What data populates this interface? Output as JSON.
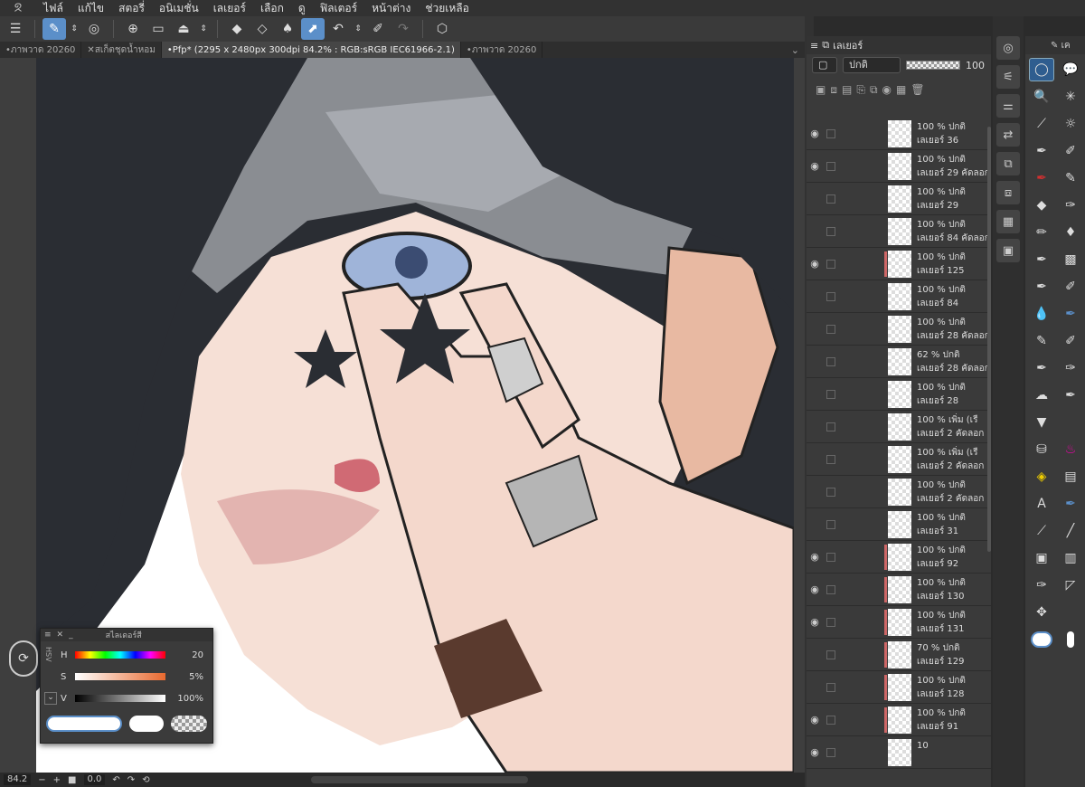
{
  "menubar": {
    "items": [
      "ไฟล์",
      "แก้ไข",
      "สตอรี่",
      "อนิเมชั่น",
      "เลเยอร์",
      "เลือก",
      "ดู",
      "ฟิลเตอร์",
      "หน้าต่าง",
      "ช่วยเหลือ"
    ]
  },
  "toolbar": {
    "icons": [
      "menu-icon",
      "layer-property-icon",
      "stepper-icon",
      "companion-icon",
      "new-file-icon",
      "open-file-icon",
      "save-icon",
      "stepper-icon",
      "eraser-icon",
      "clear-icon",
      "fill-icon",
      "transform-icon",
      "undo-icon",
      "stepper-icon",
      "pen-icon",
      "redo-icon",
      "3d-object-icon"
    ]
  },
  "tabs": [
    {
      "label": "ภาพวาด 20260",
      "active": false
    },
    {
      "label": "สเก็ตชุดน้ำหอม",
      "active": false
    },
    {
      "label": "Pfp* (2295 x 2480px 300dpi 84.2% : RGB:sRGB IEC61966-2.1)",
      "active": true
    },
    {
      "label": "ภาพวาด 20260",
      "active": false
    }
  ],
  "statusbar": {
    "zoom": "84.2",
    "angle": "0.0"
  },
  "color_slider": {
    "title": "สไลเดอร์สี",
    "mode": "HSV",
    "h_label": "H",
    "h_value": "20",
    "s_label": "S",
    "s_value": "5%",
    "v_label": "V",
    "v_value": "100%",
    "accent": "#5b8fc9"
  },
  "layer_panel": {
    "tab_label": "เลเยอร์",
    "blend_mode": "ปกติ",
    "opacity": "100",
    "layers": [
      {
        "opacity": "100 %",
        "mode": "ปกติ",
        "name": "เลเยอร์ 36",
        "visible": true,
        "marked": false
      },
      {
        "opacity": "100 %",
        "mode": "ปกติ",
        "name": "เลเยอร์ 29 คัดลอก",
        "visible": true,
        "marked": false
      },
      {
        "opacity": "100 %",
        "mode": "ปกติ",
        "name": "เลเยอร์ 29",
        "visible": false,
        "marked": false
      },
      {
        "opacity": "100 %",
        "mode": "ปกติ",
        "name": "เลเยอร์ 84 คัดลอก",
        "visible": false,
        "marked": false
      },
      {
        "opacity": "100 %",
        "mode": "ปกติ",
        "name": "เลเยอร์ 125",
        "visible": true,
        "marked": true
      },
      {
        "opacity": "100 %",
        "mode": "ปกติ",
        "name": "เลเยอร์ 84",
        "visible": false,
        "marked": false
      },
      {
        "opacity": "100 %",
        "mode": "ปกติ",
        "name": "เลเยอร์ 28 คัดลอก",
        "visible": false,
        "marked": false
      },
      {
        "opacity": "62 %",
        "mode": "ปกติ",
        "name": "เลเยอร์ 28 คัดลอก",
        "visible": false,
        "marked": false
      },
      {
        "opacity": "100 %",
        "mode": "ปกติ",
        "name": "เลเยอร์ 28",
        "visible": false,
        "marked": false
      },
      {
        "opacity": "100 %",
        "mode": "เพิ่ม (เรื",
        "name": "เลเยอร์ 2 คัดลอก",
        "visible": false,
        "marked": false
      },
      {
        "opacity": "100 %",
        "mode": "เพิ่ม (เรื",
        "name": "เลเยอร์ 2 คัดลอก",
        "visible": false,
        "marked": false
      },
      {
        "opacity": "100 %",
        "mode": "ปกติ",
        "name": "เลเยอร์ 2 คัดลอก",
        "visible": false,
        "marked": false
      },
      {
        "opacity": "100 %",
        "mode": "ปกติ",
        "name": "เลเยอร์ 31",
        "visible": false,
        "marked": false
      },
      {
        "opacity": "100 %",
        "mode": "ปกติ",
        "name": "เลเยอร์ 92",
        "visible": true,
        "marked": true
      },
      {
        "opacity": "100 %",
        "mode": "ปกติ",
        "name": "เลเยอร์ 130",
        "visible": true,
        "marked": true
      },
      {
        "opacity": "100 %",
        "mode": "ปกติ",
        "name": "เลเยอร์ 131",
        "visible": true,
        "marked": true
      },
      {
        "opacity": "70 %",
        "mode": "ปกติ",
        "name": "เลเยอร์ 129",
        "visible": false,
        "marked": true
      },
      {
        "opacity": "100 %",
        "mode": "ปกติ",
        "name": "เลเยอร์ 128",
        "visible": false,
        "marked": true
      },
      {
        "opacity": "100 %",
        "mode": "ปกติ",
        "name": "เลเยอร์ 91",
        "visible": true,
        "marked": true
      },
      {
        "opacity": "10",
        "mode": "",
        "name": "",
        "visible": true,
        "marked": false
      }
    ]
  },
  "tool_panel": {
    "tab_label": "เค"
  },
  "colors": {
    "brush_red": "#d03030",
    "accent_blue": "#5b8fc9"
  }
}
